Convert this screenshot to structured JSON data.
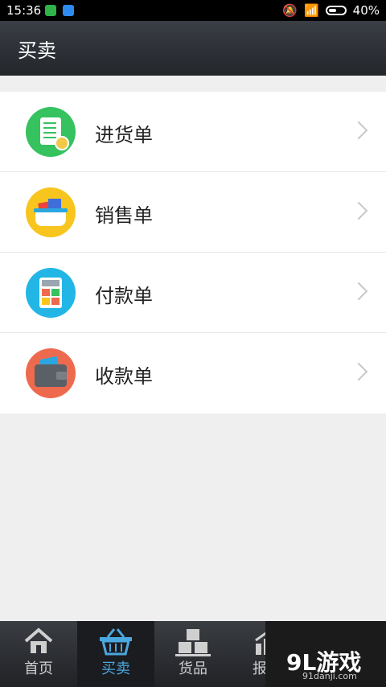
{
  "status": {
    "time": "15:36",
    "battery": "40%"
  },
  "header": {
    "title": "买卖"
  },
  "list": {
    "items": [
      {
        "label": "进货单",
        "icon": "purchase-order-icon",
        "color": "#35c25f"
      },
      {
        "label": "销售单",
        "icon": "sales-order-icon",
        "color": "#f7c51e"
      },
      {
        "label": "付款单",
        "icon": "payment-order-icon",
        "color": "#22b6e6"
      },
      {
        "label": "收款单",
        "icon": "receipt-order-icon",
        "color": "#ee6a4e"
      }
    ]
  },
  "tabs": [
    {
      "label": "首页",
      "icon": "home-icon"
    },
    {
      "label": "买卖",
      "icon": "basket-icon",
      "active": true
    },
    {
      "label": "货品",
      "icon": "boxes-icon"
    },
    {
      "label": "报",
      "icon": "chart-icon"
    },
    {
      "label": "",
      "icon": "coins-icon"
    }
  ],
  "watermark": {
    "brand": "9L游戏",
    "site": "91danji.com"
  }
}
